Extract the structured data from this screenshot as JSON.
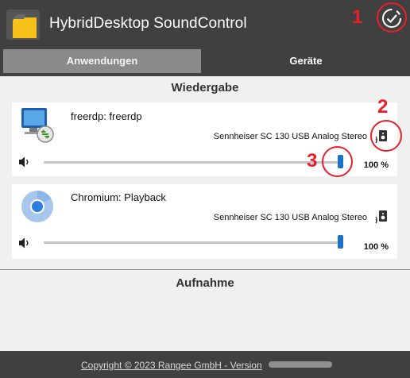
{
  "app": {
    "title": "HybridDesktop SoundControl"
  },
  "tabs": [
    {
      "label": "Anwendungen",
      "active": true
    },
    {
      "label": "Geräte",
      "active": false
    }
  ],
  "playback": {
    "heading": "Wiedergabe",
    "items": [
      {
        "name": "freerdp: freerdp",
        "device": "Sennheiser SC 130 USB Analog Stereo",
        "volume": 100,
        "volume_label": "100 %",
        "icon": "remote-desktop-icon"
      },
      {
        "name": "Chromium: Playback",
        "device": "Sennheiser SC 130 USB Analog Stereo",
        "volume": 100,
        "volume_label": "100 %",
        "icon": "chromium-icon"
      }
    ]
  },
  "recording": {
    "heading": "Aufnahme"
  },
  "footer": {
    "copyright": "Copyright © 2023 Rangee GmbH - Version"
  },
  "annotations": [
    "1",
    "2",
    "3"
  ],
  "colors": {
    "accent": "#1a72c8",
    "chrome": "#404040",
    "annotation": "#e8202a"
  }
}
